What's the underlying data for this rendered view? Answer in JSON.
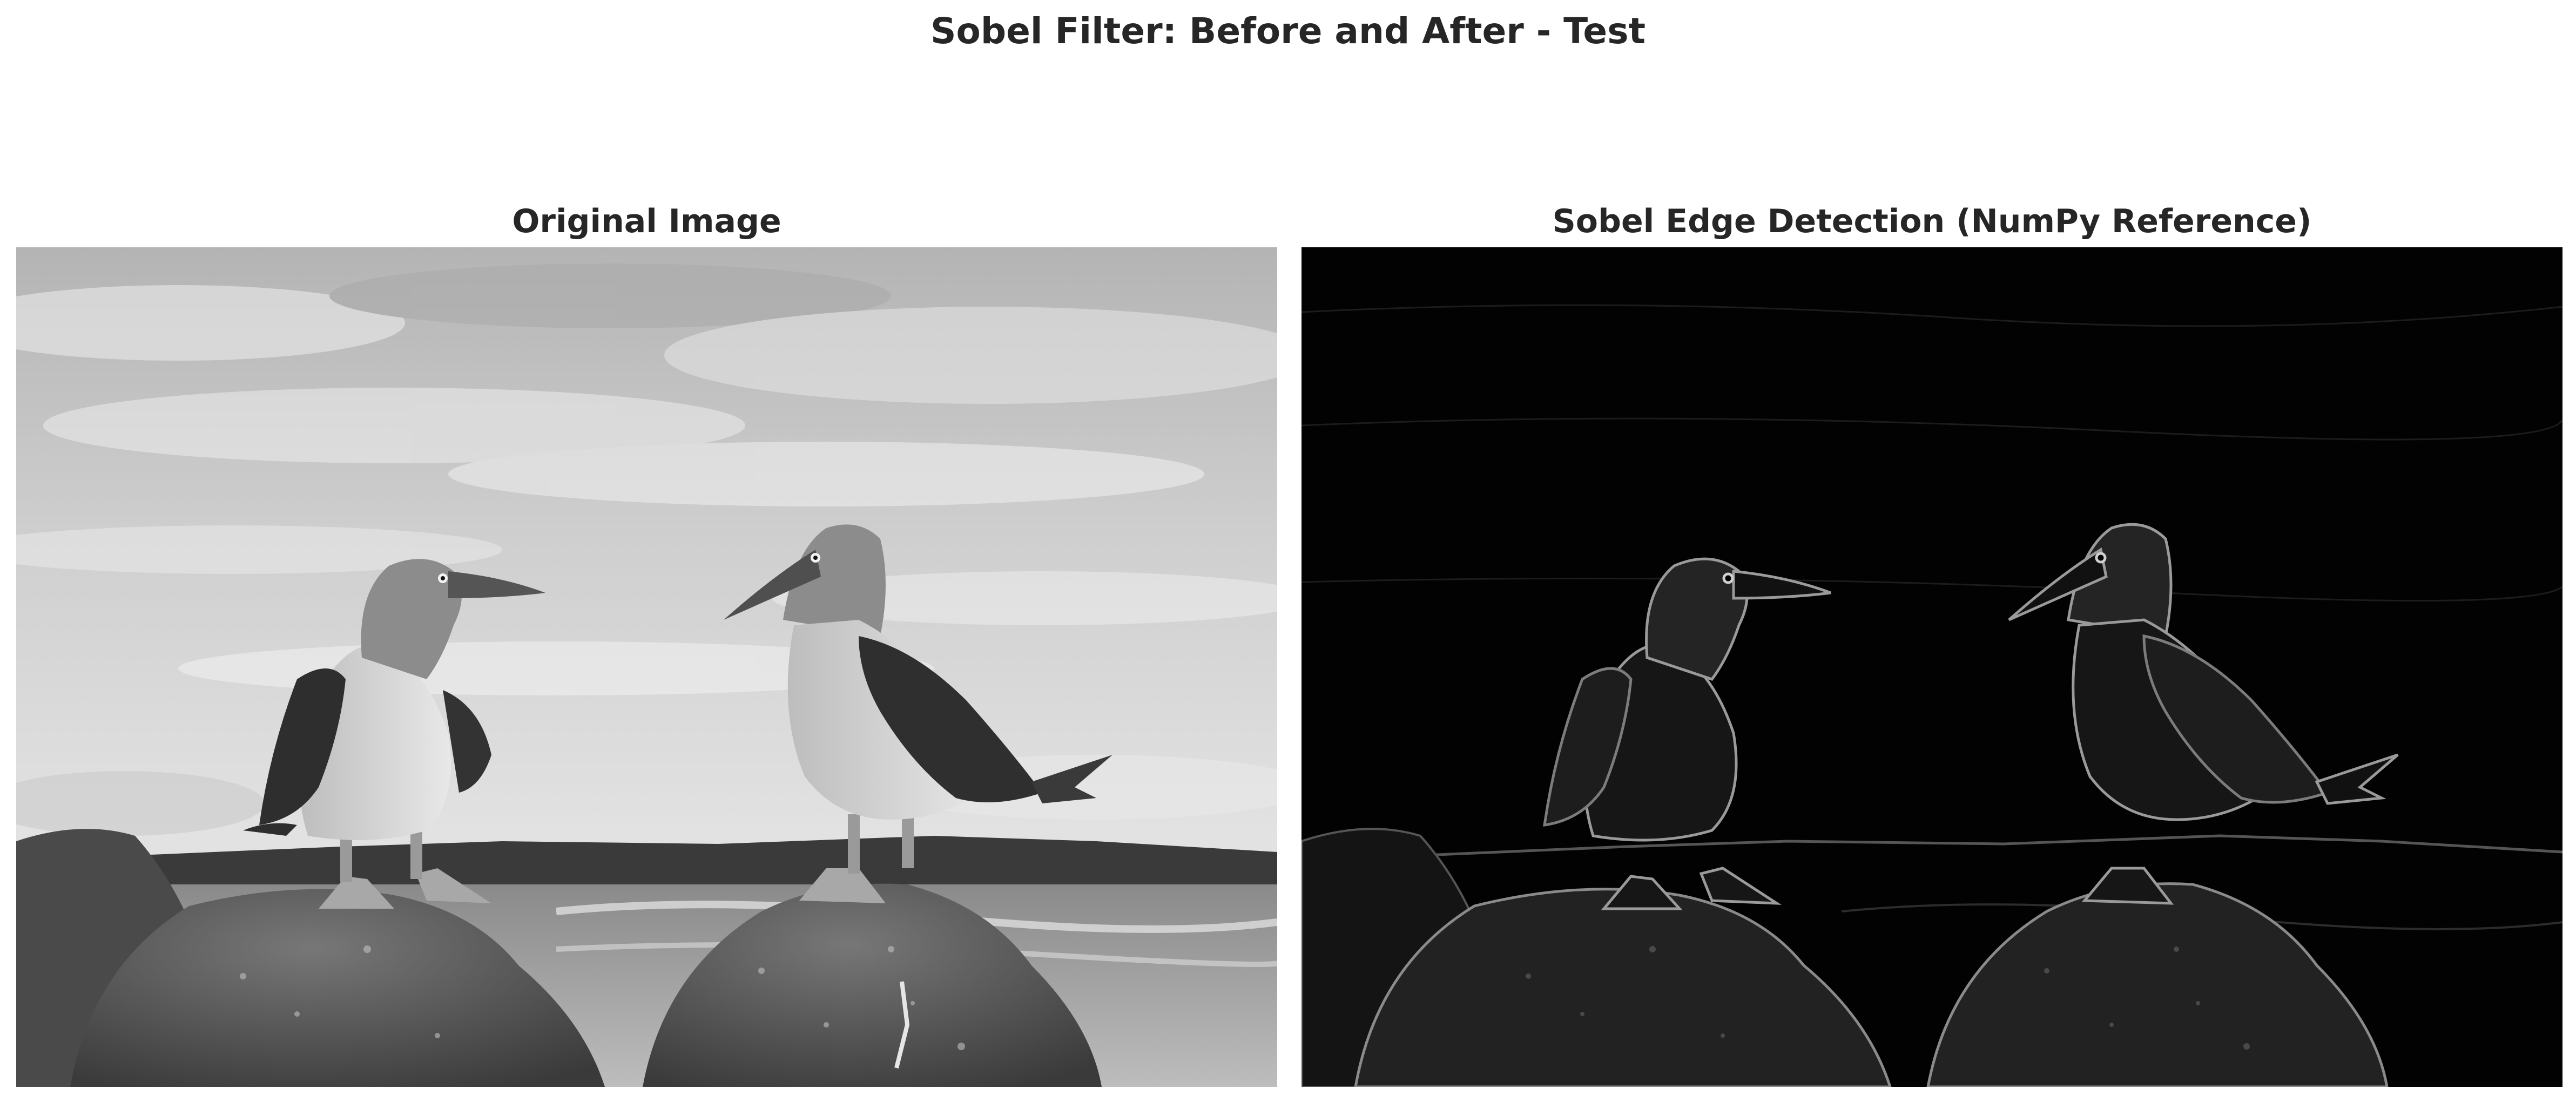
{
  "figure": {
    "title": "Sobel Filter: Before and After - Test"
  },
  "panels": [
    {
      "title": "Original Image",
      "content": "grayscale photo of two boobies standing on rocks by the sea"
    },
    {
      "title": "Sobel Edge Detection (NumPy Reference)",
      "content": "edge-detected version of the same photo"
    }
  ],
  "colors": {
    "text": "#262626",
    "edge_background": "#000000"
  }
}
